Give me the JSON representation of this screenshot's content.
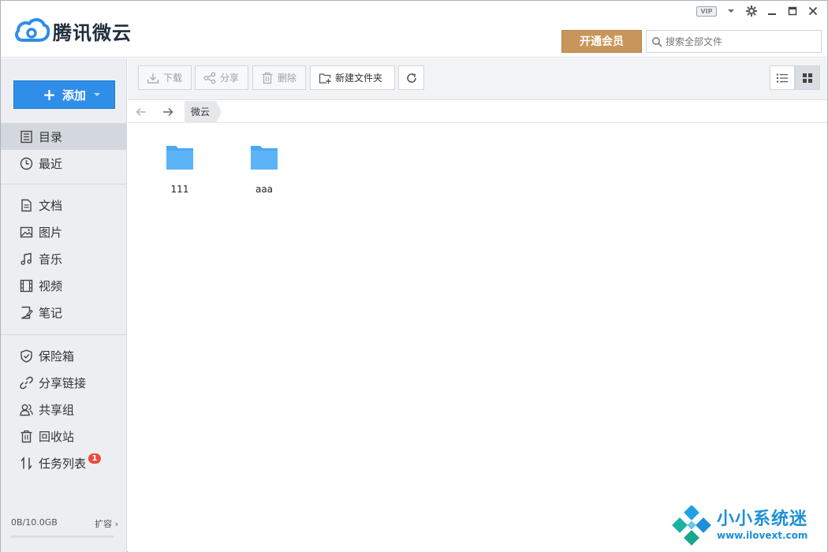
{
  "app": {
    "title": "腾讯微云",
    "vip_label": "VIP"
  },
  "header": {
    "member_button": "开通会员",
    "search_placeholder": "搜索全部文件"
  },
  "sidebar": {
    "add_button": "添加",
    "groups": [
      [
        {
          "label": "目录",
          "icon": "directory-icon",
          "active": true
        },
        {
          "label": "最近",
          "icon": "clock-icon"
        }
      ],
      [
        {
          "label": "文档",
          "icon": "document-icon"
        },
        {
          "label": "图片",
          "icon": "image-icon"
        },
        {
          "label": "音乐",
          "icon": "music-icon"
        },
        {
          "label": "视频",
          "icon": "video-icon"
        },
        {
          "label": "笔记",
          "icon": "note-icon"
        }
      ],
      [
        {
          "label": "保险箱",
          "icon": "shield-icon"
        },
        {
          "label": "分享链接",
          "icon": "link-icon"
        },
        {
          "label": "共享组",
          "icon": "group-icon"
        },
        {
          "label": "回收站",
          "icon": "trash-icon"
        },
        {
          "label": "任务列表",
          "icon": "transfer-icon",
          "badge": "1"
        }
      ]
    ],
    "storage": {
      "used": "0B/10.0GB",
      "expand": "扩容",
      "used_fraction": 0
    }
  },
  "toolbar": {
    "download": "下载",
    "share": "分享",
    "delete": "删除",
    "new_folder": "新建文件夹"
  },
  "breadcrumb": {
    "current": "微云"
  },
  "files": [
    {
      "name": "111",
      "type": "folder"
    },
    {
      "name": "aaa",
      "type": "folder"
    }
  ],
  "watermark": {
    "title": "小小系统迷",
    "url": "www.ilovext.com"
  },
  "colors": {
    "accent": "#2f8ee8",
    "member": "#c8955a",
    "folder": "#4aa8f5",
    "badge": "#e84c3d"
  }
}
